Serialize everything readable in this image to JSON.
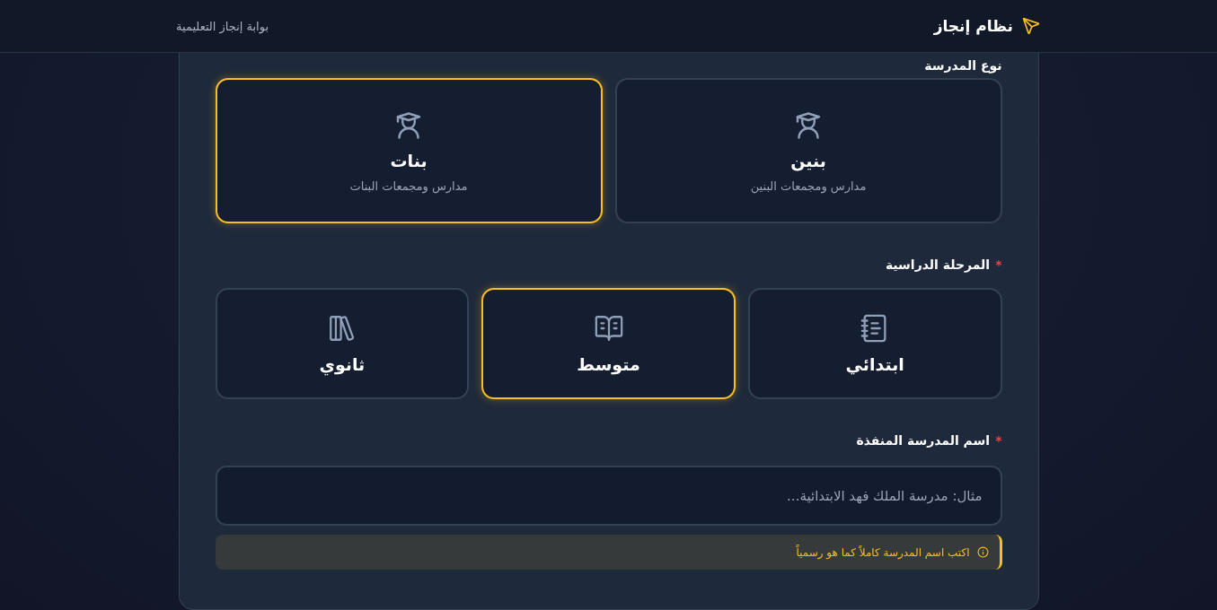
{
  "header": {
    "title": "نظام إنجاز",
    "subtitle": "بوابة إنجاز التعليمية"
  },
  "school_type": {
    "label": "نوع المدرسة",
    "options": [
      {
        "title": "بنين",
        "subtitle": "مدارس ومجمعات البنين",
        "selected": false
      },
      {
        "title": "بنات",
        "subtitle": "مدارس ومجمعات البنات",
        "selected": true
      }
    ]
  },
  "stage": {
    "label": "المرحلة الدراسية",
    "required_mark": "*",
    "options": [
      {
        "kind": "notebook",
        "title": "ابتدائي",
        "selected": false
      },
      {
        "kind": "open-book",
        "title": "متوسط",
        "selected": true
      },
      {
        "kind": "books",
        "title": "ثانوي",
        "selected": false
      }
    ]
  },
  "school_name": {
    "label": "اسم المدرسة المنفذة",
    "required_mark": "*",
    "placeholder": "مثال: مدرسة الملك فهد الابتدائية...",
    "hint": "اكتب اسم المدرسة كاملاً كما هو رسمياً"
  }
}
